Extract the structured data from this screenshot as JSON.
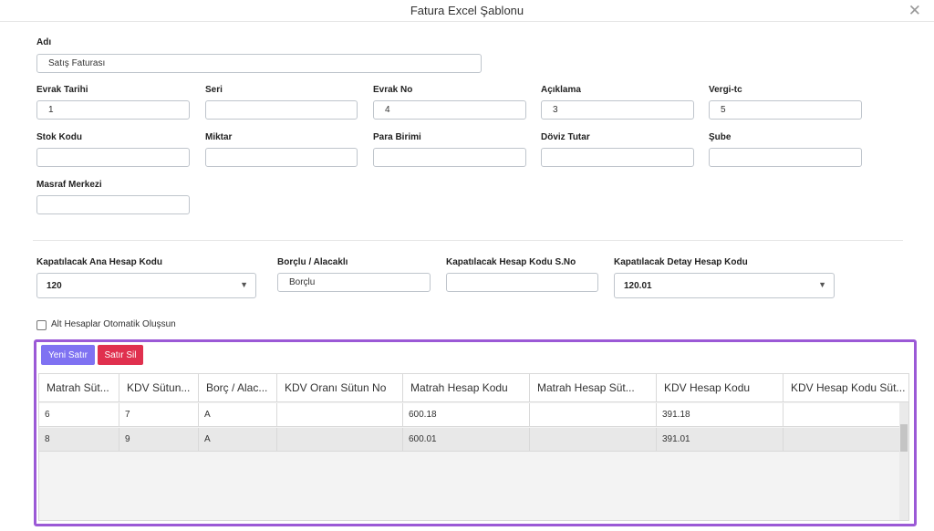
{
  "window": {
    "title": "Fatura Excel Şablonu"
  },
  "form": {
    "name_label": "Adı",
    "name_value": "Satış Faturası",
    "evrak_tarihi_label": "Evrak Tarihi",
    "evrak_tarihi_value": "1",
    "seri_label": "Seri",
    "seri_value": "",
    "evrak_no_label": "Evrak No",
    "evrak_no_value": "4",
    "aciklama_label": "Açıklama",
    "aciklama_value": "3",
    "vergi_label": "Vergi-tc",
    "vergi_value": "5",
    "stok_kodu_label": "Stok Kodu",
    "stok_kodu_value": "",
    "miktar_label": "Miktar",
    "miktar_value": "",
    "para_birimi_label": "Para Birimi",
    "para_birimi_value": "",
    "doviz_tutar_label": "Döviz Tutar",
    "doviz_tutar_value": "",
    "sube_label": "Şube",
    "sube_value": "",
    "masraf_merkezi_label": "Masraf Merkezi",
    "masraf_merkezi_value": ""
  },
  "accounts": {
    "ana_hesap_label": "Kapatılacak Ana Hesap Kodu",
    "ana_hesap_value": "120",
    "borclu_label": "Borçlu / Alacaklı",
    "borclu_value": "Borçlu",
    "hesap_sno_label": "Kapatılacak Hesap Kodu S.No",
    "hesap_sno_value": "",
    "detay_hesap_label": "Kapatılacak Detay Hesap Kodu",
    "detay_hesap_value": "120.01",
    "alt_hesaplar_label": "Alt Hesaplar Otomatik Oluşsun",
    "alt_hesaplar_checked": false
  },
  "grid": {
    "add_label": "Yeni Satır",
    "delete_label": "Satır Sil",
    "columns": [
      "Matrah Süt...",
      "KDV Sütun...",
      "Borç / Alac...",
      "KDV Oranı Sütun No",
      "Matrah Hesap Kodu",
      "Matrah Hesap Süt...",
      "KDV Hesap Kodu",
      "KDV Hesap Kodu Süt..."
    ],
    "rows": [
      [
        "6",
        "7",
        "A",
        "",
        "600.18",
        "",
        "391.18",
        ""
      ],
      [
        "8",
        "9",
        "A",
        "",
        "600.01",
        "",
        "391.01",
        ""
      ]
    ]
  },
  "colors": {
    "frame": "#9b59d6",
    "add_button": "#7f72f2",
    "delete_button": "#e0304e"
  },
  "icons": {
    "close": "close-icon",
    "dropdown": "chevron-down-icon",
    "checkbox": "checkbox-icon"
  }
}
